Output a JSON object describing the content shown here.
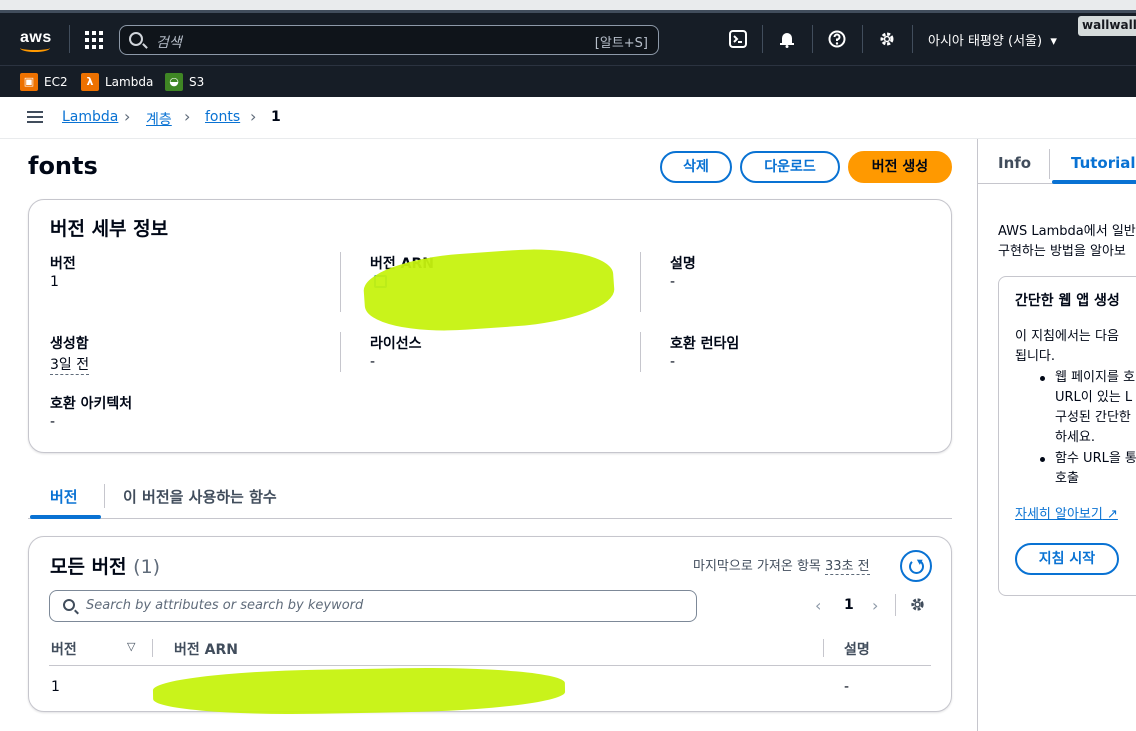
{
  "header": {
    "logo": "aws",
    "search_placeholder": "검색",
    "search_shortcut": "[알트+S]",
    "region": "아시아 태평양 (서울)",
    "badge": "wallwall"
  },
  "favorites": [
    {
      "label": "EC2",
      "color": "#ed7100"
    },
    {
      "label": "Lambda",
      "color": "#ed7100"
    },
    {
      "label": "S3",
      "color": "#3f8624"
    }
  ],
  "breadcrumb": {
    "items": [
      "Lambda",
      "계층",
      "fonts"
    ],
    "current": "1"
  },
  "page": {
    "title": "fonts",
    "buttons": {
      "delete": "삭제",
      "download": "다운로드",
      "create_version": "버전 생성"
    }
  },
  "details": {
    "title": "버전 세부 정보",
    "version_label": "버전",
    "version_value": "1",
    "arn_label": "버전 ARN",
    "description_label": "설명",
    "description_value": "-",
    "created_label": "생성함",
    "created_value": "3일 전",
    "license_label": "라이선스",
    "license_value": "-",
    "runtime_label": "호환 런타임",
    "runtime_value": "-",
    "arch_label": "호환 아키텍처",
    "arch_value": "-"
  },
  "tabs": {
    "versions": "버전",
    "functions": "이 버전을 사용하는 함수"
  },
  "versions_table": {
    "title": "모든 버전",
    "count": "(1)",
    "last_fetched_prefix": "마지막으로 가져온 항목",
    "last_fetched_time": "33초 전",
    "filter_placeholder": "Search by attributes or search by keyword",
    "page": "1",
    "columns": [
      "버전",
      "버전 ARN",
      "설명"
    ],
    "rows": [
      {
        "version": "1",
        "description": "-"
      }
    ]
  },
  "side_panel": {
    "tabs": {
      "info": "Info",
      "tutorials": "Tutorials"
    },
    "intro_line1": "AWS Lambda에서 일반",
    "intro_line2": "구현하는 방법을 알아보",
    "card_title": "간단한 웹 앱 생성",
    "card_text1": "이 지침에서는 다음",
    "card_text2": "됩니다.",
    "bullet1": [
      "웹 페이지를 호",
      "URL이 있는 L",
      "구성된 간단한",
      "하세요."
    ],
    "bullet2": [
      "함수 URL을 통",
      "호출"
    ],
    "learn_more": "자세히 알아보기",
    "start_button": "지침 시작"
  }
}
